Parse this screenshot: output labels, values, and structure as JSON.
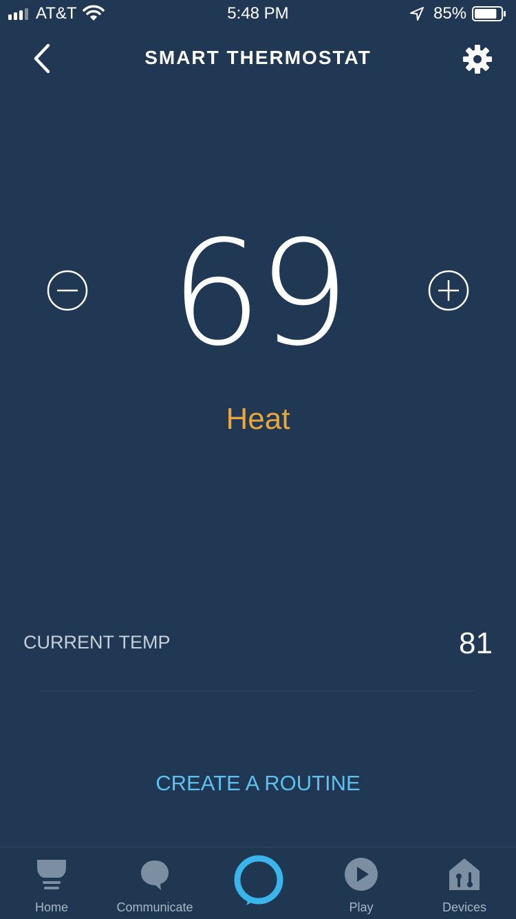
{
  "status_bar": {
    "carrier": "AT&T",
    "time": "5:48 PM",
    "battery": "85%",
    "battery_level": 0.85
  },
  "header": {
    "title": "SMART THERMOSTAT"
  },
  "thermostat": {
    "setpoint": "69",
    "mode": "Heat"
  },
  "current_temp": {
    "label": "CURRENT TEMP",
    "value": "81"
  },
  "routine_link": "CREATE A ROUTINE",
  "tabs": [
    {
      "label": "Home",
      "icon": "home-icon"
    },
    {
      "label": "Communicate",
      "icon": "chat-bubble-icon"
    },
    {
      "label": "",
      "icon": "alexa-ring-icon"
    },
    {
      "label": "Play",
      "icon": "play-icon"
    },
    {
      "label": "Devices",
      "icon": "devices-icon"
    }
  ],
  "colors": {
    "background": "#203853",
    "mode_heat": "#e8a73c",
    "link": "#5cc0f0",
    "alexa_ring": "#3ab4ea"
  }
}
